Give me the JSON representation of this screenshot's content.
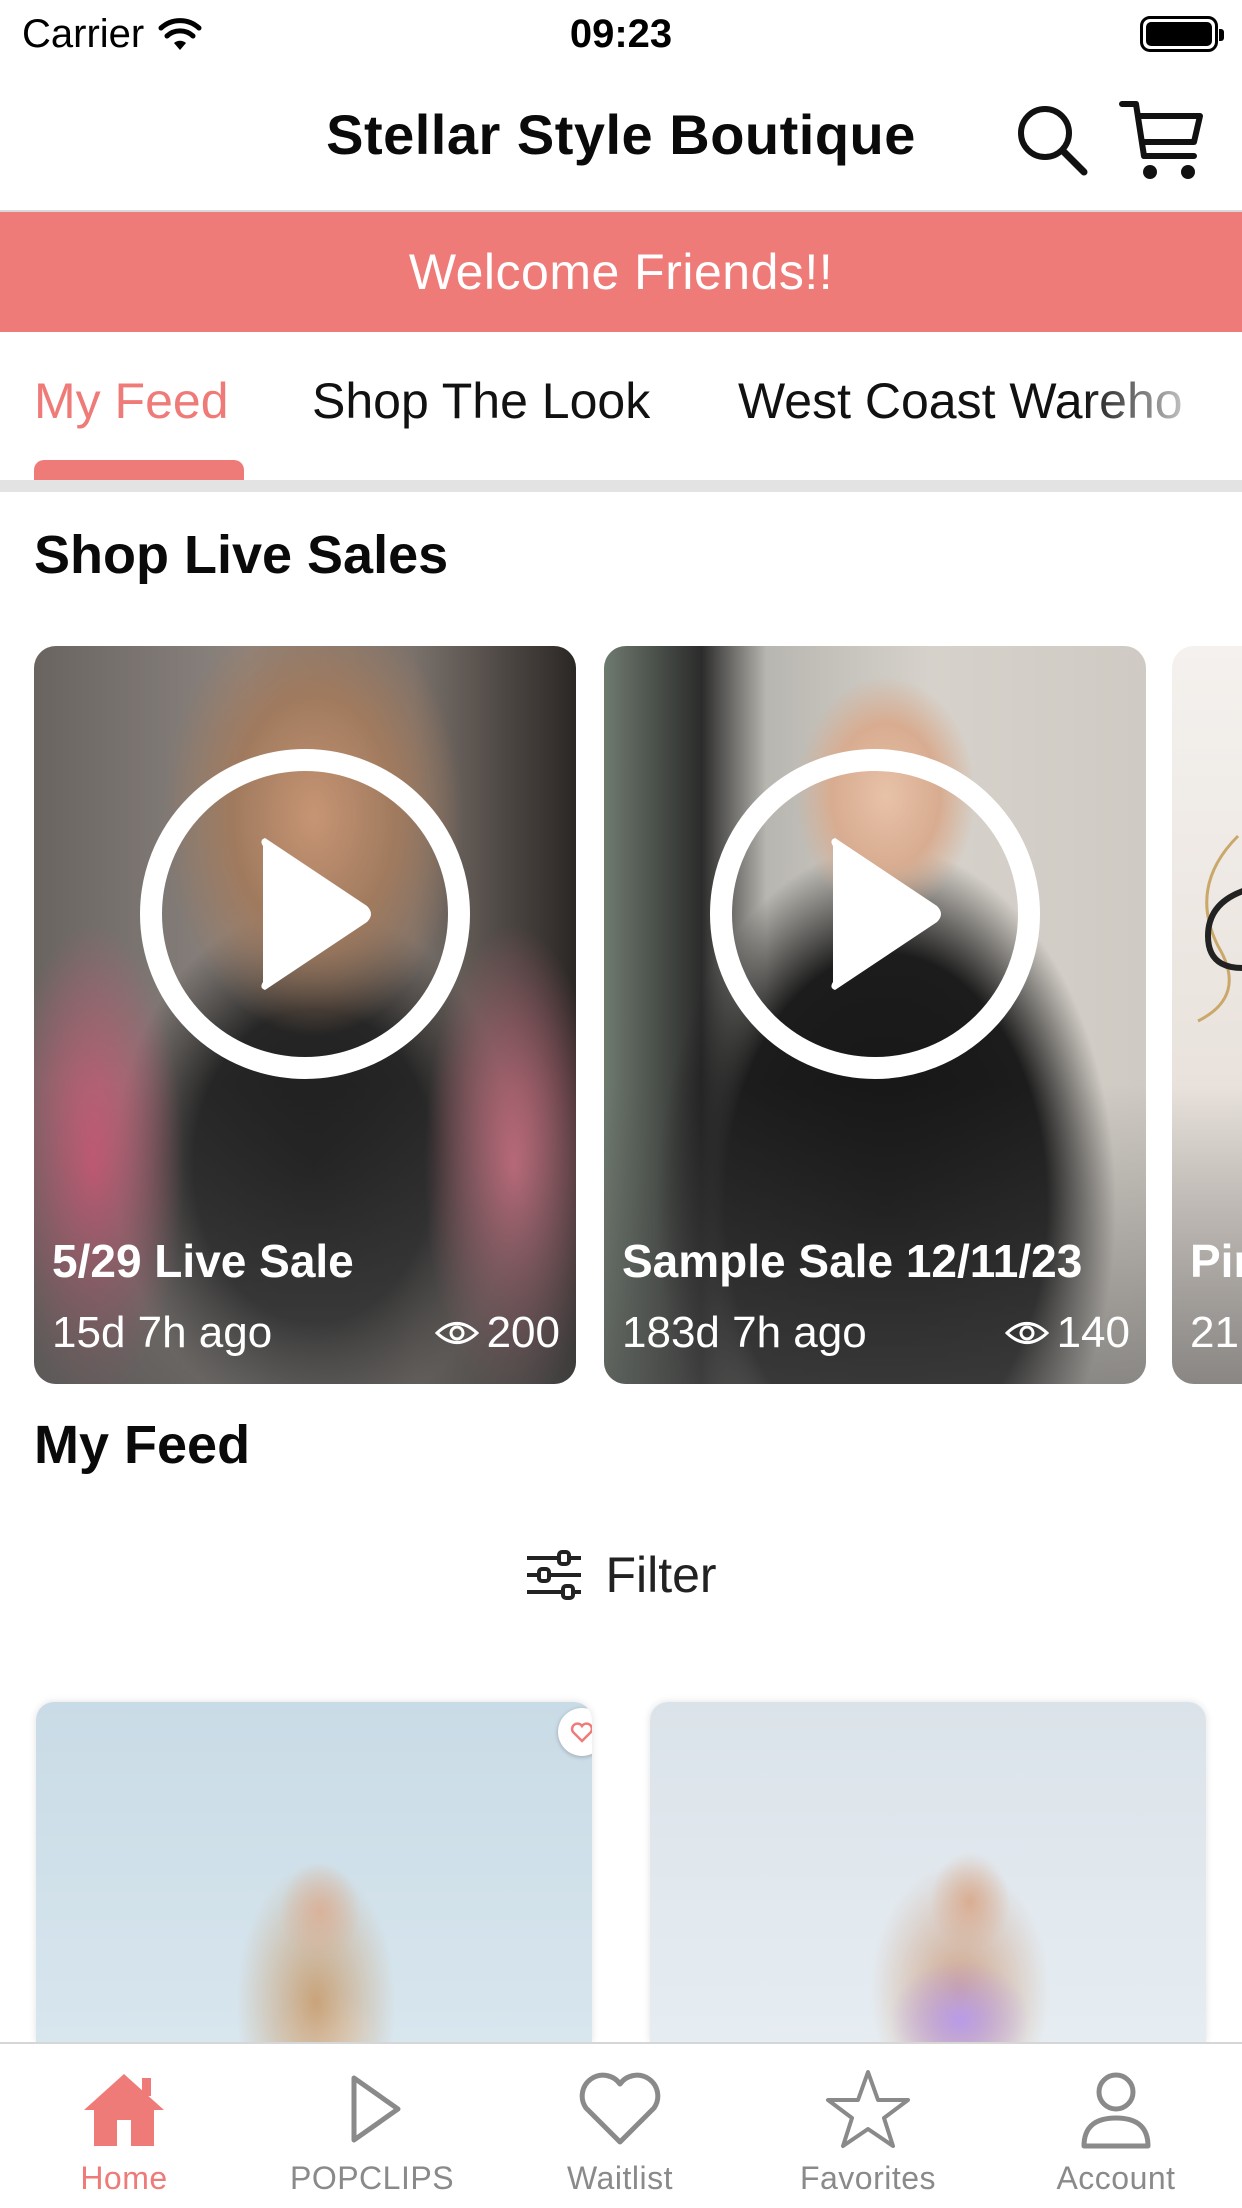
{
  "status_bar": {
    "carrier": "Carrier",
    "time": "09:23"
  },
  "header": {
    "title": "Stellar Style Boutique"
  },
  "banner": {
    "text": "Welcome Friends!!"
  },
  "tabs": [
    {
      "label": "My Feed",
      "active": true
    },
    {
      "label": "Shop The Look",
      "active": false
    },
    {
      "label": "West Coast Wareho",
      "active": false
    }
  ],
  "sections": {
    "live_sales_title": "Shop Live Sales",
    "feed_title": "My Feed"
  },
  "live_sales": [
    {
      "title": "5/29 Live Sale",
      "age": "15d 7h ago",
      "views": "200"
    },
    {
      "title": "Sample Sale 12/11/23",
      "age": "183d 7h ago",
      "views": "140"
    },
    {
      "title": "Pir",
      "age": "21"
    }
  ],
  "filter": {
    "label": "Filter"
  },
  "bottom_nav": [
    {
      "label": "Home",
      "icon": "home-icon",
      "active": true
    },
    {
      "label": "POPCLIPS",
      "icon": "play-icon",
      "active": false
    },
    {
      "label": "Waitlist",
      "icon": "heart-icon",
      "active": false
    },
    {
      "label": "Favorites",
      "icon": "star-icon",
      "active": false
    },
    {
      "label": "Account",
      "icon": "person-icon",
      "active": false
    }
  ],
  "colors": {
    "accent": "#ef7b79",
    "inactive": "#8a8a8a",
    "divider": "#e3e3e3"
  }
}
